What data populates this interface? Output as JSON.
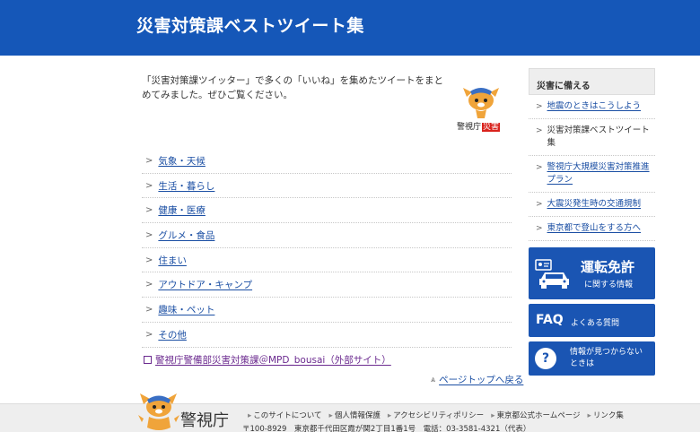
{
  "header": {
    "title": "災害対策課ベストツイート集"
  },
  "intro": {
    "text": "「災害対策課ツイッター」で多くの「いいね」を集めたツイートをまとめてみました。ぜひご覧ください。"
  },
  "mascot": {
    "label_text": "警視庁",
    "label_badge": "災害"
  },
  "categories": [
    {
      "label": "気象・天候"
    },
    {
      "label": "生活・暮らし"
    },
    {
      "label": "健康・医療"
    },
    {
      "label": "グルメ・食品"
    },
    {
      "label": "住まい"
    },
    {
      "label": "アウトドア・キャンプ"
    },
    {
      "label": "趣味・ペット"
    },
    {
      "label": "その他"
    }
  ],
  "external_link": {
    "label": "警視庁警備部災害対策課＠MPD_bousai（外部サイト）"
  },
  "page_top": {
    "label": "ページトップへ戻る"
  },
  "sidebar": {
    "heading": "災害に備える",
    "items": [
      {
        "label": "地震のときはこうしよう",
        "current": false
      },
      {
        "label": "災害対策課ベストツイート集",
        "current": true
      },
      {
        "label": "警視庁大規模災害対策推進プラン",
        "current": false
      },
      {
        "label": "大震災発生時の交通規制",
        "current": false
      },
      {
        "label": "東京都で登山をする方へ",
        "current": false
      }
    ]
  },
  "banners": {
    "drive": {
      "title": "運転免許",
      "subtitle": "に関する情報"
    },
    "faq": {
      "title": "FAQ",
      "subtitle": "よくある質問"
    },
    "info": {
      "symbol": "?",
      "line1": "情報が見つからない",
      "line2": "ときは"
    }
  },
  "footer": {
    "org": "警視庁",
    "links": [
      {
        "label": "このサイトについて"
      },
      {
        "label": "個人情報保護"
      },
      {
        "label": "アクセシビリティポリシー"
      },
      {
        "label": "東京都公式ホームページ"
      },
      {
        "label": "リンク集"
      }
    ],
    "address": "〒100-8929　東京都千代田区霞が関2丁目1番1号　電話：03-3581-4321（代表）"
  },
  "colors": {
    "header_bg": "#1557b8",
    "banner_bg": "#1a55b3",
    "link": "#1a4ea3",
    "visited_link": "#6b2a8f",
    "badge_red": "#d9231d"
  }
}
